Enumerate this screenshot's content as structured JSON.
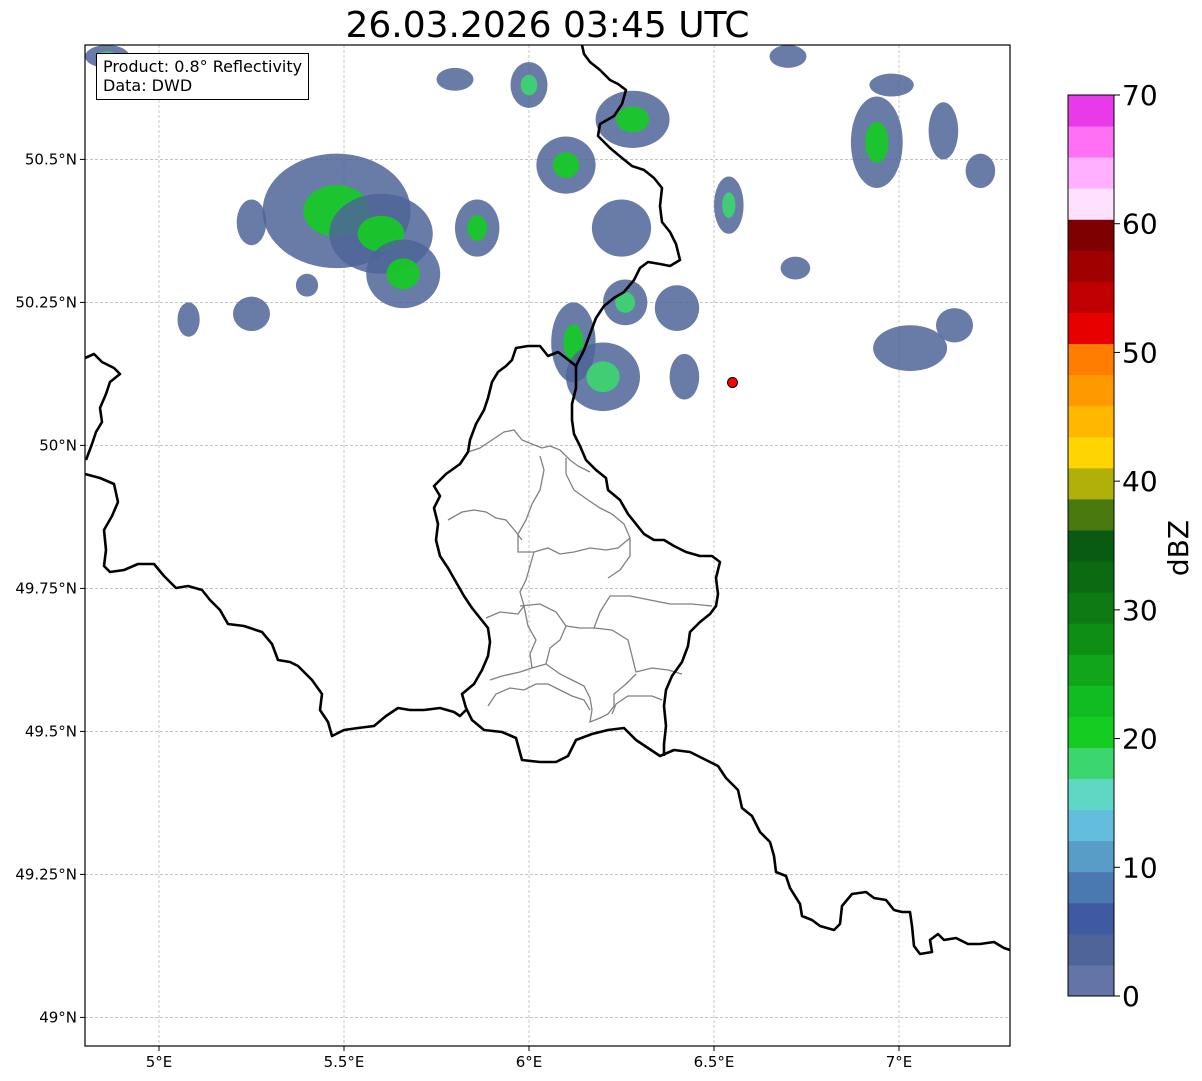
{
  "title": "26.03.2026 03:45 UTC",
  "info_box": {
    "product": "Product: 0.8° Reflectivity",
    "data": "Data: DWD"
  },
  "axes": {
    "lat_ticks": [
      "50.5°N",
      "50.25°N",
      "50°N",
      "49.75°N",
      "49.5°N",
      "49.25°N",
      "49°N"
    ],
    "lon_ticks": [
      "5°E",
      "5.5°E",
      "6°E",
      "6.5°E",
      "7°E"
    ],
    "extent": {
      "lon_min": 4.8,
      "lon_max": 7.3,
      "lat_min": 48.95,
      "lat_max": 50.7
    },
    "grid": "dashed light gray"
  },
  "marker": {
    "lon": 6.55,
    "lat": 50.11,
    "color": "#ff0000"
  },
  "colorbar": {
    "label": "dBZ",
    "tick_labels": [
      "70",
      "60",
      "50",
      "40",
      "30",
      "20",
      "10",
      "0"
    ],
    "range": [
      0,
      70
    ],
    "colors_bottom_to_top": [
      "#6474a6",
      "#4f6599",
      "#3f5aa0",
      "#4a78b0",
      "#579dc7",
      "#63bddc",
      "#5ed8c4",
      "#3cd66e",
      "#14cc22",
      "#11bb22",
      "#10a51a",
      "#0f8e16",
      "#0e7a14",
      "#0c6a12",
      "#085b10",
      "#4a7a0f",
      "#b0b00a",
      "#ffd400",
      "#ffb700",
      "#ff9900",
      "#ff7d00",
      "#e60000",
      "#c00000",
      "#a00000",
      "#7e0000",
      "#ffe0ff",
      "#ffb0ff",
      "#ff70f5",
      "#e83ae8"
    ]
  },
  "layers": {
    "country_borders": "black, bold",
    "admin_borders": "gray, thin",
    "reflectivity_cells": "blue-green radar echoes"
  }
}
